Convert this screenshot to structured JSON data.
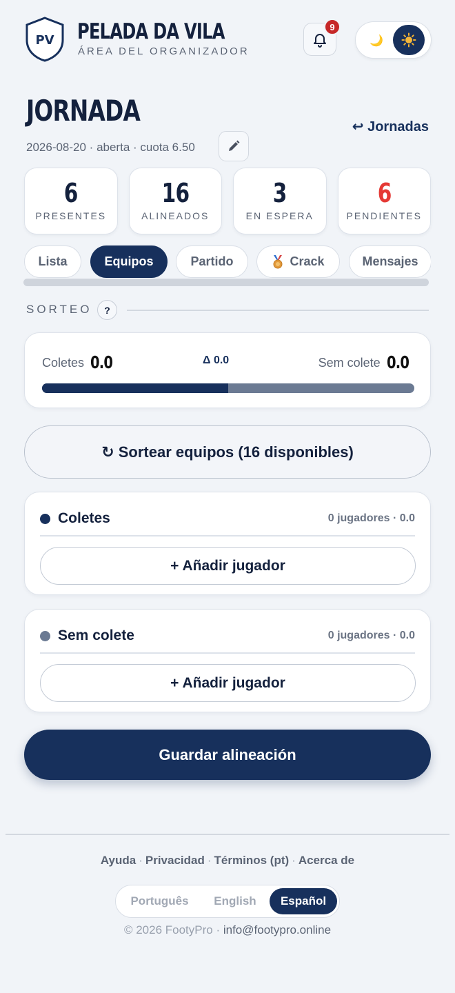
{
  "brand": {
    "initials": "PV",
    "title": "PELADA DA VILA",
    "subtitle": "ÁREA DEL ORGANIZADOR"
  },
  "notifications": {
    "count": "9",
    "icon": "bell-icon"
  },
  "theme": {
    "moon": "🌙",
    "sun": "✹",
    "selected": "light"
  },
  "page": {
    "title": "JORNADA",
    "back_label": "↩ Jornadas",
    "meta": "2026-08-20 · aberta · cuota 6.50"
  },
  "stats": [
    {
      "value": "6",
      "label": "PRESENTES"
    },
    {
      "value": "16",
      "label": "ALINEADOS"
    },
    {
      "value": "3",
      "label": "EN ESPERA"
    },
    {
      "value": "6",
      "label": "PENDIENTES"
    }
  ],
  "tabs": [
    {
      "label": "Lista"
    },
    {
      "label": "Equipos",
      "active": true
    },
    {
      "label": "Partido"
    },
    {
      "label": "Crack",
      "icon": "medal-icon"
    },
    {
      "label": "Mensajes"
    }
  ],
  "sorteo": {
    "label": "SORTEO",
    "help": "?",
    "left_label": "Coletes",
    "left_value": "0.0",
    "delta": "Δ 0.0",
    "right_label": "Sem colete",
    "right_value": "0.0",
    "balance_fraction": 0.5,
    "shuffle_label": "↻ Sortear equipos (16 disponibles)"
  },
  "teams": [
    {
      "name": "Coletes",
      "count": "0 jugadores · 0.0",
      "color": "#17305c",
      "add_label": "+ Añadir jugador"
    },
    {
      "name": "Sem colete",
      "count": "0 jugadores · 0.0",
      "color": "#6b7a93",
      "add_label": "+ Añadir jugador"
    }
  ],
  "save_label": "Guardar alineación",
  "footer": {
    "links": [
      "Ayuda",
      "Privacidad",
      "Términos (pt)",
      "Acerca de"
    ],
    "languages": [
      "Português",
      "English",
      "Español"
    ],
    "active_language": "Español",
    "copyright": "© 2026 FootyPro · ",
    "email": "info@footypro.online"
  },
  "colors": {
    "primary": "#17305c",
    "danger": "#e53935",
    "background": "#f1f4f8"
  }
}
